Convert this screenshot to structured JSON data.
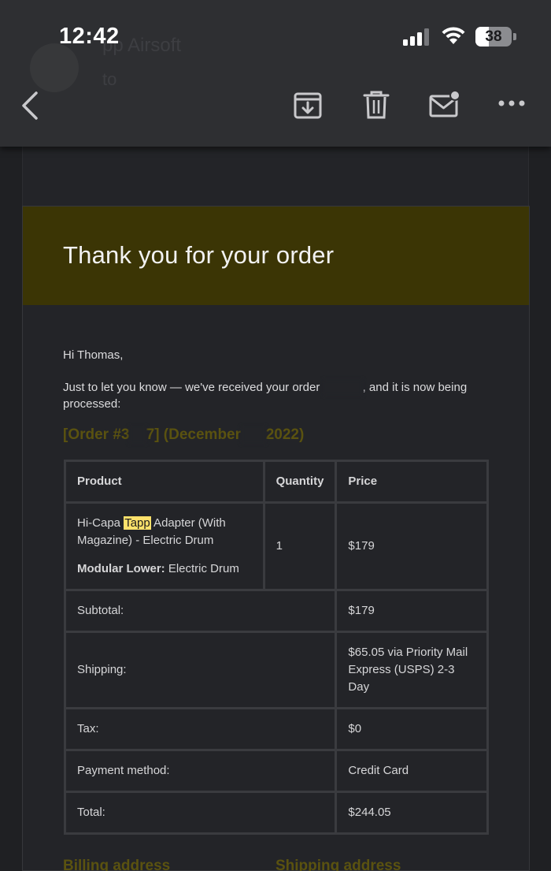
{
  "status_bar": {
    "time": "12:42",
    "battery": "38"
  },
  "header_ghost": {
    "from_partial": "pp Airsoft",
    "to_partial": "to "
  },
  "toolbar": {
    "icons": [
      "back-icon",
      "archive-icon",
      "trash-icon",
      "mark-unread-icon",
      "more-icon"
    ]
  },
  "email": {
    "banner_title": "Thank you for your order",
    "greeting": "Hi Thomas,",
    "intro_part1": "Just to let you know — we've received your order ",
    "intro_part2": ", and it is now being processed:",
    "order_heading": "[Order #3",
    "order_heading_b": "7] (December",
    "order_heading_c": "2022)",
    "table": {
      "headers": [
        "Product",
        "Quantity",
        "Price"
      ],
      "product_name_a": "Hi-Capa ",
      "product_name_highlight": "Tapp",
      "product_name_b": " Adapter (With Magazine) - Electric Drum",
      "option_label": "Modular Lower:",
      "option_value": " Electric Drum",
      "quantity": "1",
      "price": "$179",
      "totals": [
        {
          "label": "Subtotal:",
          "value": "$179"
        },
        {
          "label": "Shipping:",
          "value": "$65.05 via Priority Mail Express (USPS) 2-3 Day"
        },
        {
          "label": "Tax:",
          "value": "$0"
        },
        {
          "label": "Payment method:",
          "value": "Credit Card"
        },
        {
          "label": "Total:",
          "value": "$244.05"
        }
      ]
    },
    "billing_heading": "Billing address",
    "shipping_heading": "Shipping address"
  },
  "colors": {
    "banner": "#3b3505",
    "heading_accent": "#5a5210",
    "highlight": "#ffe16b"
  }
}
